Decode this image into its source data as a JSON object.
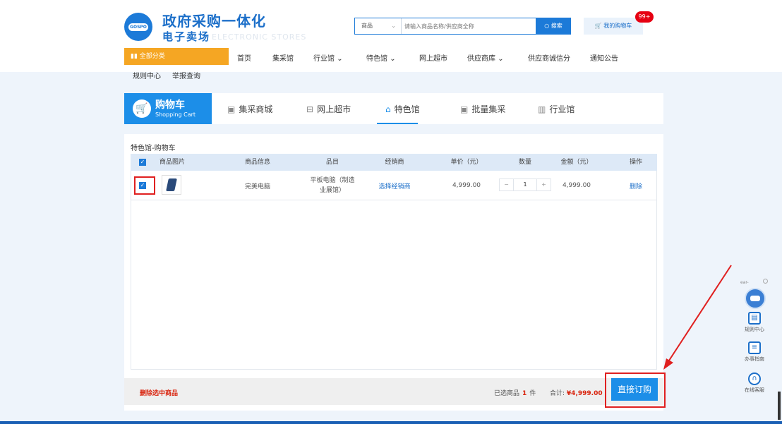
{
  "header": {
    "logo_badge": "GOSPO",
    "title": "政府采购一体化",
    "subtitle": "电子卖场",
    "subtitle_en": "ELECTRONIC STORES",
    "search": {
      "category": "商品",
      "placeholder": "请输入商品名称/供应商全称",
      "button": "搜索"
    },
    "cart_link": "我的购物车",
    "cart_badge": "99+"
  },
  "nav": {
    "all_categories": "全部分类",
    "items": [
      "首页",
      "集采馆",
      "行业馆",
      "特色馆",
      "网上超市",
      "供应商库",
      "供应商诚信分",
      "通知公告"
    ],
    "items_row2": [
      "规则中心",
      "举报查询"
    ]
  },
  "tabs": {
    "cart_label": "购物车",
    "cart_label_en": "Shopping Cart",
    "items": [
      "集采商城",
      "网上超市",
      "特色馆",
      "批量集采",
      "行业馆"
    ]
  },
  "cart": {
    "title": "特色馆-购物车",
    "headers": [
      "商品图片",
      "商品信息",
      "品目",
      "经销商",
      "单价（元）",
      "数量",
      "金额（元）",
      "操作"
    ],
    "row": {
      "name": "完美电脑",
      "category": "平板电脑（制造业展馆）",
      "dealer": "选择经销商",
      "unit_price": "4,999.00",
      "qty": "1",
      "amount": "4,999.00",
      "action": "删除"
    },
    "footer": {
      "delete_selected": "删除选中商品",
      "selected_prefix": "已选商品",
      "selected_count": "1",
      "selected_suffix": "件",
      "total_label": "合计:",
      "total_amount": "¥4,999.00",
      "order_button": "直接订购"
    }
  },
  "sidebar": {
    "chat_label": "ear-",
    "items": [
      "规则中心",
      "办事指南",
      "在线客服"
    ]
  },
  "colors": {
    "primary": "#1c8ee8",
    "accent": "#f5a623",
    "danger": "#d9230d",
    "highlight_border": "#e02020"
  }
}
